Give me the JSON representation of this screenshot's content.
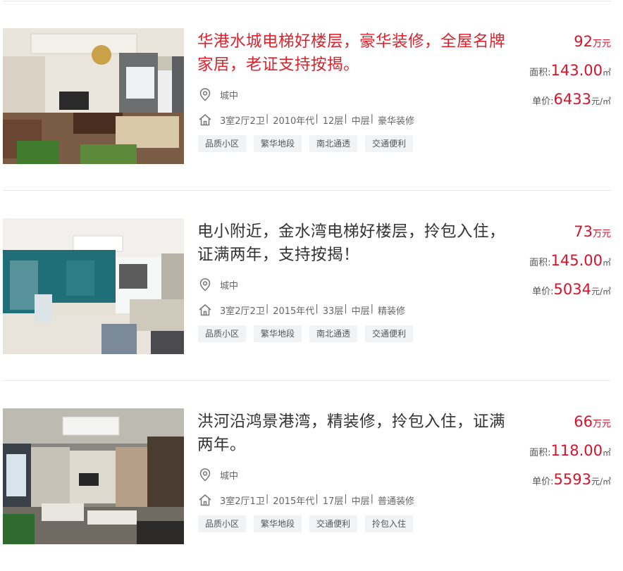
{
  "listings": [
    {
      "title": "华港水城电梯好楼层，豪华装修，全屋名牌家居，老证支持按揭。",
      "highlighted": true,
      "location": "城中",
      "attributes": [
        "3室2厅2卫",
        "2010年代",
        "12层",
        "中层",
        "豪华装修"
      ],
      "tags": [
        "品质小区",
        "繁华地段",
        "南北通透",
        "交通便利"
      ],
      "total_price": "92",
      "total_unit": "万元",
      "area_label": "面积:",
      "area": "143.00",
      "area_unit": "㎡",
      "unit_price_label": "单价:",
      "unit_price": "6433",
      "unit_price_unit": "元/㎡",
      "photo_icon": "living-room-photo-classic"
    },
    {
      "title": "电小附近，金水湾电梯好楼层，拎包入住，证满两年，支持按揭！",
      "highlighted": false,
      "location": "城中",
      "attributes": [
        "3室2厅2卫",
        "2015年代",
        "33层",
        "中层",
        "精装修"
      ],
      "tags": [
        "品质小区",
        "繁华地段",
        "南北通透",
        "交通便利"
      ],
      "total_price": "73",
      "total_unit": "万元",
      "area_label": "面积:",
      "area": "145.00",
      "area_unit": "㎡",
      "unit_price_label": "单价:",
      "unit_price": "5034",
      "unit_price_unit": "元/㎡",
      "photo_icon": "living-room-photo-teal"
    },
    {
      "title": "洪河沿鸿景港湾，精装修，拎包入住，证满两年。",
      "highlighted": false,
      "location": "城中",
      "attributes": [
        "3室2厅1卫",
        "2015年代",
        "17层",
        "中层",
        "普通装修"
      ],
      "tags": [
        "品质小区",
        "繁华地段",
        "交通便利",
        "拎包入住"
      ],
      "total_price": "66",
      "total_unit": "万元",
      "area_label": "面积:",
      "area": "118.00",
      "area_unit": "㎡",
      "unit_price_label": "单价:",
      "unit_price": "5593",
      "unit_price_unit": "元/㎡",
      "photo_icon": "living-room-photo-panorama"
    }
  ],
  "icons": {
    "location": "location-pin-icon",
    "house": "house-icon"
  },
  "colors": {
    "accent": "#d6132b",
    "title_highlight": "#e0202b",
    "tag_bg": "#f2f3f5"
  }
}
